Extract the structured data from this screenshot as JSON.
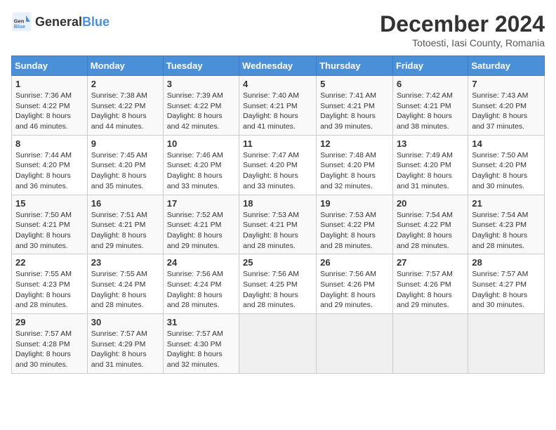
{
  "logo": {
    "general": "General",
    "blue": "Blue"
  },
  "title": "December 2024",
  "location": "Totoesti, Iasi County, Romania",
  "days_of_week": [
    "Sunday",
    "Monday",
    "Tuesday",
    "Wednesday",
    "Thursday",
    "Friday",
    "Saturday"
  ],
  "weeks": [
    [
      {
        "day": "1",
        "sunrise": "7:36 AM",
        "sunset": "4:22 PM",
        "daylight": "8 hours and 46 minutes."
      },
      {
        "day": "2",
        "sunrise": "7:38 AM",
        "sunset": "4:22 PM",
        "daylight": "8 hours and 44 minutes."
      },
      {
        "day": "3",
        "sunrise": "7:39 AM",
        "sunset": "4:22 PM",
        "daylight": "8 hours and 42 minutes."
      },
      {
        "day": "4",
        "sunrise": "7:40 AM",
        "sunset": "4:21 PM",
        "daylight": "8 hours and 41 minutes."
      },
      {
        "day": "5",
        "sunrise": "7:41 AM",
        "sunset": "4:21 PM",
        "daylight": "8 hours and 39 minutes."
      },
      {
        "day": "6",
        "sunrise": "7:42 AM",
        "sunset": "4:21 PM",
        "daylight": "8 hours and 38 minutes."
      },
      {
        "day": "7",
        "sunrise": "7:43 AM",
        "sunset": "4:20 PM",
        "daylight": "8 hours and 37 minutes."
      }
    ],
    [
      {
        "day": "8",
        "sunrise": "7:44 AM",
        "sunset": "4:20 PM",
        "daylight": "8 hours and 36 minutes."
      },
      {
        "day": "9",
        "sunrise": "7:45 AM",
        "sunset": "4:20 PM",
        "daylight": "8 hours and 35 minutes."
      },
      {
        "day": "10",
        "sunrise": "7:46 AM",
        "sunset": "4:20 PM",
        "daylight": "8 hours and 33 minutes."
      },
      {
        "day": "11",
        "sunrise": "7:47 AM",
        "sunset": "4:20 PM",
        "daylight": "8 hours and 33 minutes."
      },
      {
        "day": "12",
        "sunrise": "7:48 AM",
        "sunset": "4:20 PM",
        "daylight": "8 hours and 32 minutes."
      },
      {
        "day": "13",
        "sunrise": "7:49 AM",
        "sunset": "4:20 PM",
        "daylight": "8 hours and 31 minutes."
      },
      {
        "day": "14",
        "sunrise": "7:50 AM",
        "sunset": "4:20 PM",
        "daylight": "8 hours and 30 minutes."
      }
    ],
    [
      {
        "day": "15",
        "sunrise": "7:50 AM",
        "sunset": "4:21 PM",
        "daylight": "8 hours and 30 minutes."
      },
      {
        "day": "16",
        "sunrise": "7:51 AM",
        "sunset": "4:21 PM",
        "daylight": "8 hours and 29 minutes."
      },
      {
        "day": "17",
        "sunrise": "7:52 AM",
        "sunset": "4:21 PM",
        "daylight": "8 hours and 29 minutes."
      },
      {
        "day": "18",
        "sunrise": "7:53 AM",
        "sunset": "4:21 PM",
        "daylight": "8 hours and 28 minutes."
      },
      {
        "day": "19",
        "sunrise": "7:53 AM",
        "sunset": "4:22 PM",
        "daylight": "8 hours and 28 minutes."
      },
      {
        "day": "20",
        "sunrise": "7:54 AM",
        "sunset": "4:22 PM",
        "daylight": "8 hours and 28 minutes."
      },
      {
        "day": "21",
        "sunrise": "7:54 AM",
        "sunset": "4:23 PM",
        "daylight": "8 hours and 28 minutes."
      }
    ],
    [
      {
        "day": "22",
        "sunrise": "7:55 AM",
        "sunset": "4:23 PM",
        "daylight": "8 hours and 28 minutes."
      },
      {
        "day": "23",
        "sunrise": "7:55 AM",
        "sunset": "4:24 PM",
        "daylight": "8 hours and 28 minutes."
      },
      {
        "day": "24",
        "sunrise": "7:56 AM",
        "sunset": "4:24 PM",
        "daylight": "8 hours and 28 minutes."
      },
      {
        "day": "25",
        "sunrise": "7:56 AM",
        "sunset": "4:25 PM",
        "daylight": "8 hours and 28 minutes."
      },
      {
        "day": "26",
        "sunrise": "7:56 AM",
        "sunset": "4:26 PM",
        "daylight": "8 hours and 29 minutes."
      },
      {
        "day": "27",
        "sunrise": "7:57 AM",
        "sunset": "4:26 PM",
        "daylight": "8 hours and 29 minutes."
      },
      {
        "day": "28",
        "sunrise": "7:57 AM",
        "sunset": "4:27 PM",
        "daylight": "8 hours and 30 minutes."
      }
    ],
    [
      {
        "day": "29",
        "sunrise": "7:57 AM",
        "sunset": "4:28 PM",
        "daylight": "8 hours and 30 minutes."
      },
      {
        "day": "30",
        "sunrise": "7:57 AM",
        "sunset": "4:29 PM",
        "daylight": "8 hours and 31 minutes."
      },
      {
        "day": "31",
        "sunrise": "7:57 AM",
        "sunset": "4:30 PM",
        "daylight": "8 hours and 32 minutes."
      },
      null,
      null,
      null,
      null
    ]
  ],
  "labels": {
    "sunrise": "Sunrise:",
    "sunset": "Sunset:",
    "daylight": "Daylight:"
  }
}
